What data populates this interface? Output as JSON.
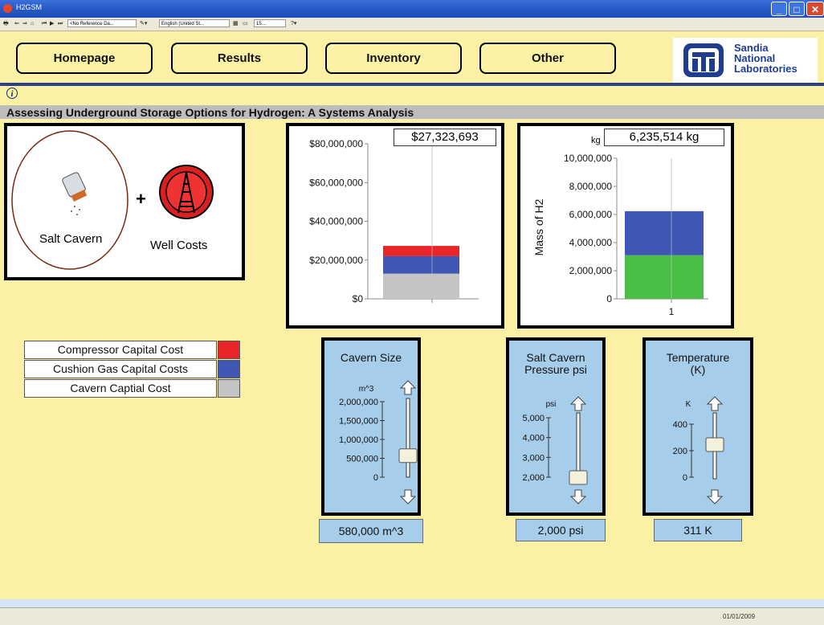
{
  "window": {
    "title": "H2GSM"
  },
  "toolbar": {
    "reference_dropdown": "<No Reference Da...",
    "language_dropdown": "English (United St...",
    "zoom_dropdown": "15..."
  },
  "nav": {
    "homepage": "Homepage",
    "results": "Results",
    "inventory": "Inventory",
    "other": "Other"
  },
  "logo": {
    "line1": "Sandia",
    "line2": "National",
    "line3": "Laboratories"
  },
  "header": {
    "title": "Assessing Underground Storage Options for Hydrogen:  A Systems Analysis"
  },
  "diagram": {
    "salt_cavern_label": "Salt Cavern",
    "plus": "+",
    "well_costs_label": "Well Costs"
  },
  "cost_chart": {
    "value_readout": "$27,323,693"
  },
  "mass_chart": {
    "unit": "kg",
    "value_readout": "6,235,514 kg"
  },
  "legend": {
    "items": [
      {
        "label": "Compressor Capital Cost",
        "color": "#e8262a"
      },
      {
        "label": "Cushion Gas Capital Costs",
        "color": "#3f56b5"
      },
      {
        "label": "Cavern Captial Cost",
        "color": "#c4c4c4"
      }
    ]
  },
  "sliders": {
    "cavern_size": {
      "title": "Cavern Size",
      "unit": "m^3",
      "ticks": [
        "2,000,000",
        "1,500,000",
        "1,000,000",
        "500,000",
        "0"
      ],
      "value": 580000,
      "max": 2000000,
      "min": 0,
      "readout": "580,000 m^3"
    },
    "pressure": {
      "title_line1": "Salt Cavern",
      "title_line2": "Pressure psi",
      "unit": "psi",
      "ticks": [
        "5,000",
        "4,000",
        "3,000",
        "2,000"
      ],
      "value": 2000,
      "max": 5000,
      "min": 2000,
      "readout": "2,000 psi"
    },
    "temperature": {
      "title_line1": "Temperature",
      "title_line2": "(K)",
      "unit": "K",
      "ticks": [
        "400",
        "200",
        "0"
      ],
      "value": 311,
      "max": 500,
      "min": 0,
      "readout": "311 K"
    }
  },
  "status": {
    "date": "01/01/2009"
  },
  "chart_data": [
    {
      "type": "bar",
      "stacked": true,
      "title": "",
      "ylabel": "",
      "xlabel": "",
      "ylim": [
        0,
        80000000
      ],
      "yticks": [
        "$0",
        "$20,000,000",
        "$40,000,000",
        "$60,000,000",
        "$80,000,000"
      ],
      "ytick_values": [
        0,
        20000000,
        40000000,
        60000000,
        80000000
      ],
      "categories": [
        ""
      ],
      "series": [
        {
          "name": "Cavern Captial Cost",
          "color": "#c4c4c4",
          "values": [
            13000000
          ]
        },
        {
          "name": "Cushion Gas Capital Costs",
          "color": "#3f56b5",
          "values": [
            9000000
          ]
        },
        {
          "name": "Compressor Capital Cost",
          "color": "#e8262a",
          "values": [
            5323693
          ]
        }
      ]
    },
    {
      "type": "bar",
      "stacked": true,
      "title": "",
      "ylabel": "Mass of H2",
      "xlabel": "",
      "ylim": [
        0,
        10000000
      ],
      "yticks": [
        "0",
        "2,000,000",
        "4,000,000",
        "6,000,000",
        "8,000,000",
        "10,000,000"
      ],
      "ytick_values": [
        0,
        2000000,
        4000000,
        6000000,
        8000000,
        10000000
      ],
      "categories": [
        "1"
      ],
      "series": [
        {
          "color": "#4bbf45",
          "values": [
            3100000
          ]
        },
        {
          "color": "#3f56b5",
          "values": [
            3135514
          ]
        }
      ]
    }
  ]
}
